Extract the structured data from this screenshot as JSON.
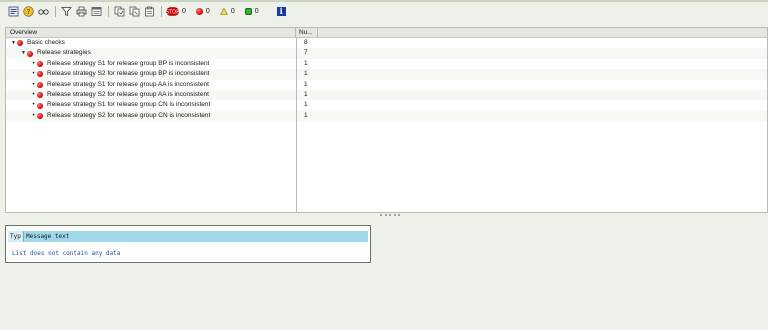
{
  "toolbar": {
    "buttons": [
      "details",
      "help",
      "glasses",
      "filter",
      "print",
      "export",
      "copy",
      "paste",
      "clipboard"
    ],
    "counters": [
      {
        "kind": "stop",
        "value": "0"
      },
      {
        "kind": "error",
        "value": "0"
      },
      {
        "kind": "warning",
        "value": "0"
      },
      {
        "kind": "success",
        "value": "0"
      }
    ],
    "info_label": "i"
  },
  "tree": {
    "columns": {
      "overview": "Overview",
      "number": "Nu..."
    },
    "rows": [
      {
        "level": 0,
        "expander": "▼",
        "text": "Basic checks",
        "count": "8"
      },
      {
        "level": 1,
        "expander": "▼",
        "text": "Release strategies",
        "count": "7"
      },
      {
        "level": 2,
        "expander": "•",
        "text": "Release strategy S1 for release group BP is inconsistent",
        "count": "1"
      },
      {
        "level": 2,
        "expander": "•",
        "text": "Release strategy S2 for release group BP is inconsistent",
        "count": "1"
      },
      {
        "level": 2,
        "expander": "•",
        "text": "Release strategy S1 for release group AA is inconsistent",
        "count": "1"
      },
      {
        "level": 2,
        "expander": "•",
        "text": "Release strategy S2 for release group AA is inconsistent",
        "count": "1"
      },
      {
        "level": 2,
        "expander": "•",
        "text": "Release strategy S1 for release group CN is inconsistent",
        "count": "1"
      },
      {
        "level": 2,
        "expander": "•",
        "text": "Release strategy S2 for release group CN is inconsistent",
        "count": "1"
      }
    ]
  },
  "messages": {
    "col_type": "Typ",
    "col_text": "Message text",
    "empty_text": "List does not contain any data"
  },
  "colors": {
    "error": "#c40000",
    "header_cyan": "#9fd8ea",
    "empty_text": "#1f4f9a"
  }
}
